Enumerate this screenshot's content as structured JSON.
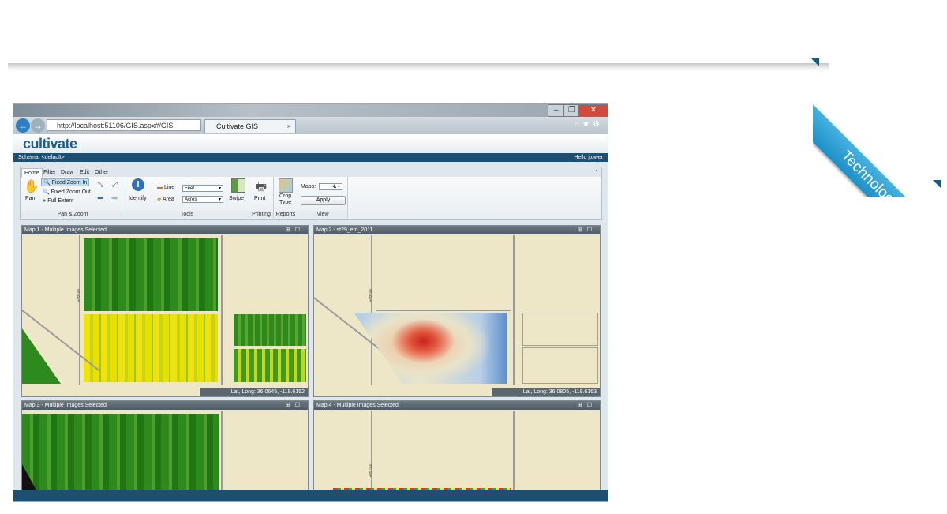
{
  "ribbon": {
    "label": "Technology"
  },
  "browser": {
    "url": "http://localhost:51106/GIS.aspx#/GIS",
    "tab_title": "Cultivate GIS",
    "close_tab": "×"
  },
  "app": {
    "logo": "cultivate",
    "schema": "Schema: <default>",
    "greeting": "Hello jtower"
  },
  "toolbar": {
    "tabs": [
      "Home",
      "Filter",
      "Draw",
      "Edit",
      "Other"
    ],
    "pan_zoom": {
      "pan": "Pan",
      "fixed_zoom_in": "Fixed Zoom In",
      "fixed_zoom_out": "Fixed Zoom Out",
      "full_extent": "Full Extent",
      "label": "Pan & Zoom"
    },
    "tools": {
      "identify": "Identify",
      "line": "Line",
      "area": "Area",
      "line_unit": "Feet",
      "area_unit": "Acres",
      "swipe": "Swipe",
      "label": "Tools"
    },
    "printing": {
      "print": "Print",
      "label": "Printing"
    },
    "reports": {
      "crop_type_1": "Crop",
      "crop_type_2": "Type",
      "label": "Reports"
    },
    "view": {
      "maps_label": "Maps:",
      "maps_value": "4",
      "apply": "Apply",
      "label": "View"
    }
  },
  "maps": [
    {
      "title": "Map 1 - Multiple Images Selected",
      "coords": "Lat, Long: 36.0645, -119.6152"
    },
    {
      "title": "Map 2 - st29_em_2011",
      "coords": "Lat, Long: 36.0805, -119.6163"
    },
    {
      "title": "Map 3 - Multiple Images Selected",
      "coords": ""
    },
    {
      "title": "Map 4 - Multiple Images Selected",
      "coords": ""
    }
  ],
  "road_label": "9th Ave",
  "colors": {
    "ribbon": "#2a9fd6",
    "app_bar": "#1d4f72",
    "map_bg": "#eee7c7",
    "ndvi_green": "#2f8f1f",
    "ndvi_yellow": "#f1e20c",
    "heat_red": "#d42a20",
    "heat_blue": "#4f87c9"
  }
}
